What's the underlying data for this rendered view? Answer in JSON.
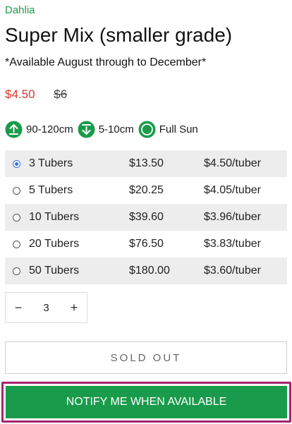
{
  "product": {
    "vendor": "Dahlia",
    "title": "Super Mix (smaller grade)",
    "availability_note": "*Available August through to December*",
    "price_sale": "$4.50",
    "price_compare": "$6",
    "brand_color": "#1a9b4b",
    "sale_color": "#e0362b"
  },
  "attributes": [
    {
      "icon": "height-up-icon",
      "label": "90-120cm"
    },
    {
      "icon": "depth-down-icon",
      "label": "5-10cm"
    },
    {
      "icon": "full-sun-icon",
      "label": "Full Sun"
    }
  ],
  "variants": [
    {
      "qty": "3 Tubers",
      "price": "$13.50",
      "per": "$4.50/tuber",
      "selected": true
    },
    {
      "qty": "5 Tubers",
      "price": "$20.25",
      "per": "$4.05/tuber",
      "selected": false
    },
    {
      "qty": "10 Tubers",
      "price": "$39.60",
      "per": "$3.96/tuber",
      "selected": false
    },
    {
      "qty": "20 Tubers",
      "price": "$76.50",
      "per": "$3.83/tuber",
      "selected": false
    },
    {
      "qty": "50 Tubers",
      "price": "$180.00",
      "per": "$3.60/tuber",
      "selected": false
    }
  ],
  "quantity": {
    "value": "3",
    "minus": "−",
    "plus": "+"
  },
  "buttons": {
    "sold_out": "SOLD OUT",
    "notify": "NOTIFY ME WHEN AVAILABLE"
  }
}
